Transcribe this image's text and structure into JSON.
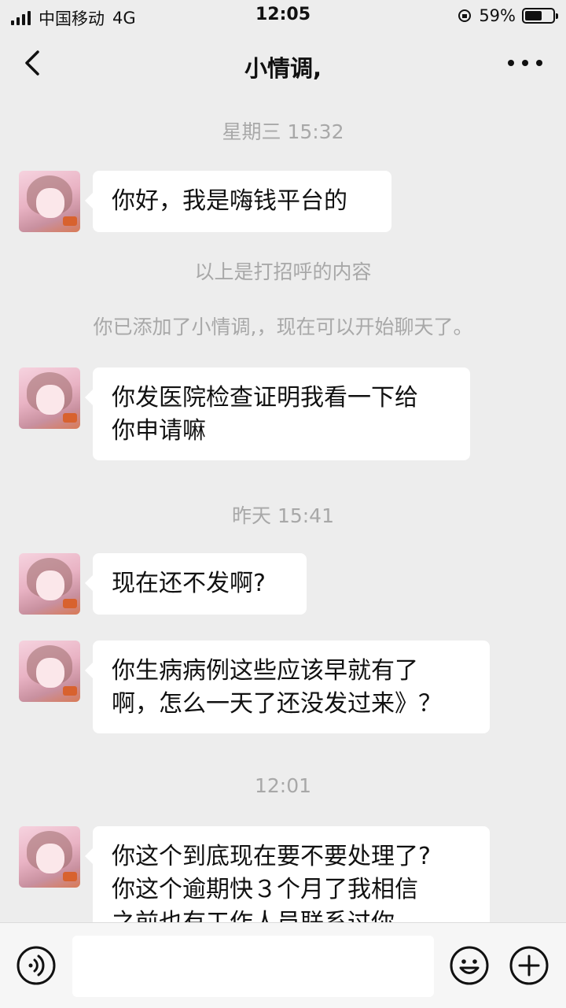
{
  "status_bar": {
    "carrier": "中国移动",
    "network": "4G",
    "time": "12:05",
    "battery_percent": "59%",
    "battery_level": 0.59
  },
  "nav": {
    "title": "小情调,",
    "back_icon": "chevron-left-icon",
    "more_icon": "more-dots-icon"
  },
  "chat": {
    "timestamps": [
      "星期三 15:32",
      "昨天 15:41",
      "12:01"
    ],
    "system_messages": [
      "以上是打招呼的内容",
      "你已添加了小情调,，现在可以开始聊天了。"
    ],
    "messages": [
      {
        "lines": [
          "你好，我是嗨钱平台的"
        ]
      },
      {
        "lines": [
          "你发医院检查证明我看一下给",
          "你申请嘛"
        ]
      },
      {
        "lines": [
          "现在还不发啊?"
        ]
      },
      {
        "lines": [
          "你生病病例这些应该早就有了",
          "啊，怎么一天了还没发过来》？"
        ]
      },
      {
        "lines": [
          "你这个到底现在要不要处理了?",
          "你这个逾期快３个月了我相信",
          "之前也有工作人员联系过你"
        ]
      }
    ]
  },
  "input_bar": {
    "voice_icon": "voice-icon",
    "emoji_icon": "emoji-icon",
    "plus_icon": "plus-icon",
    "text_value": ""
  },
  "colors": {
    "background": "#ededed",
    "bubble": "#ffffff",
    "muted_text": "#a8a8a8"
  }
}
